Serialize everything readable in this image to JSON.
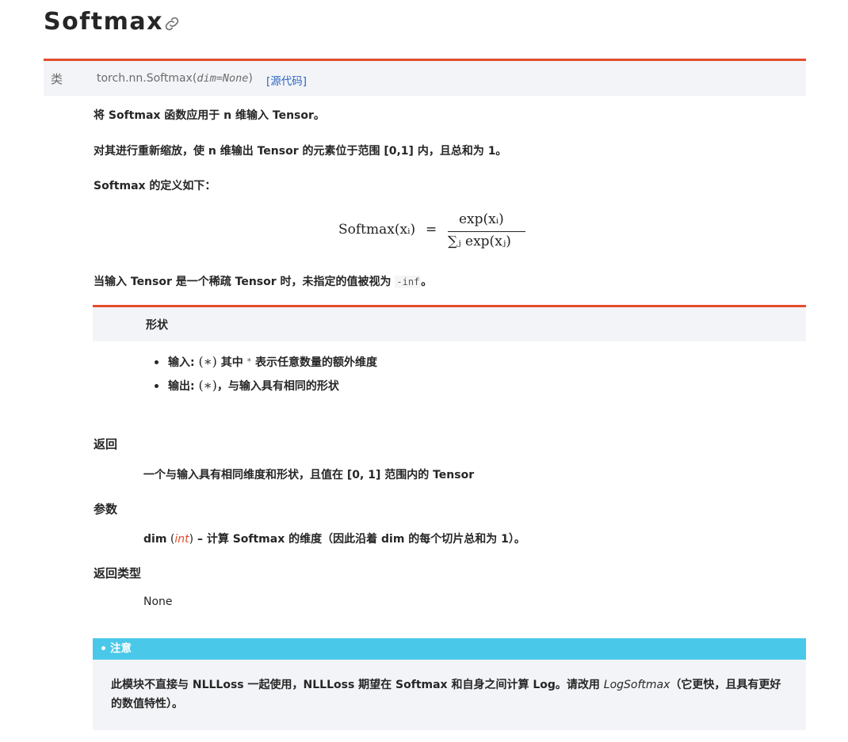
{
  "header": {
    "title": "Softmax"
  },
  "signature": {
    "keyword": "类",
    "name": "torch.nn.Softmax",
    "open_paren": "(",
    "param": "dim=None",
    "close_paren": ")",
    "source_link": "[源代码]"
  },
  "description": {
    "line1": "将 Softmax 函数应用于 n 维输入 Tensor。",
    "line2": "对其进行重新缩放，使 n 维输出 Tensor 的元素位于范围 [0,1] 内，且总和为 1。",
    "line3": "Softmax 的定义如下：",
    "line4_prefix": "当输入 Tensor 是一个稀疏 Tensor 时，未指定的值被视为",
    "line4_code": "-inf",
    "line4_suffix": "。"
  },
  "formula": {
    "lhs": "Softmax(xᵢ)",
    "eq": "=",
    "numerator": "exp(xᵢ)",
    "denominator": "∑ⱼ exp(xⱼ)"
  },
  "shape": {
    "label": "形状",
    "input_prefix": "输入: ",
    "input_math": "(∗)",
    "input_mid": " 其中 ",
    "input_star": "*",
    "input_suffix": " 表示任意数量的额外维度",
    "output_prefix": "输出: ",
    "output_math": "(∗)",
    "output_suffix": "，与输入具有相同的形状"
  },
  "returns": {
    "heading": "返回",
    "text": "一个与输入具有相同维度和形状，且值在 [0, 1] 范围内的 Tensor"
  },
  "params": {
    "heading": "参数",
    "name": "dim",
    "type_open": " (",
    "type": "int",
    "type_close": ")",
    "desc": " – 计算 Softmax 的维度（因此沿着 dim 的每个切片总和为 1）。"
  },
  "return_type": {
    "heading": "返回类型",
    "value": "None"
  },
  "note": {
    "heading": "注意",
    "text_before": "此模块不直接与 NLLLoss 一起使用，NLLLoss 期望在 Softmax 和自身之间计算 Log。请改用 ",
    "link": "LogSoftmax",
    "text_after": "（它更快，且具有更好的数值特性）。"
  },
  "colors": {
    "accent": "#e44c2c",
    "note": "#4ac8ea",
    "link": "#2a65c4",
    "panel": "#f3f4f7"
  }
}
